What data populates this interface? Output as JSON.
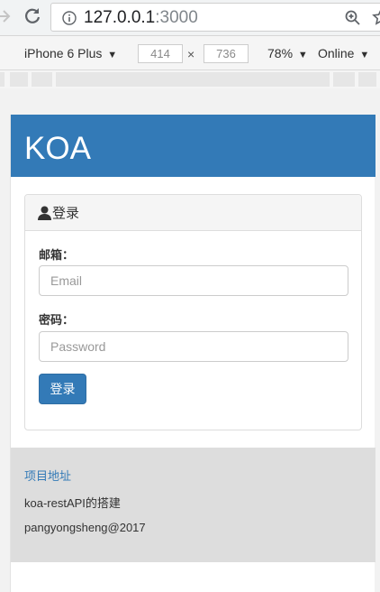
{
  "browser": {
    "url_host": "127.0.0.1",
    "url_port": ":3000"
  },
  "device_toolbar": {
    "device": "iPhone 6 Plus",
    "width": "414",
    "height": "736",
    "times": "×",
    "zoom": "78%",
    "network": "Online",
    "caret": "▼"
  },
  "page": {
    "brand": "KOA",
    "panel_title": "登录",
    "email_label": "邮箱：",
    "email_placeholder": "Email",
    "password_label": "密码：",
    "password_placeholder": "Password",
    "login_button": "登录",
    "footer": {
      "link": "项目地址",
      "line1": "koa-restAPI的搭建",
      "line2": "pangyongsheng@2017"
    }
  },
  "colors": {
    "primary": "#337ab7",
    "footer_bg": "#dddddd"
  }
}
